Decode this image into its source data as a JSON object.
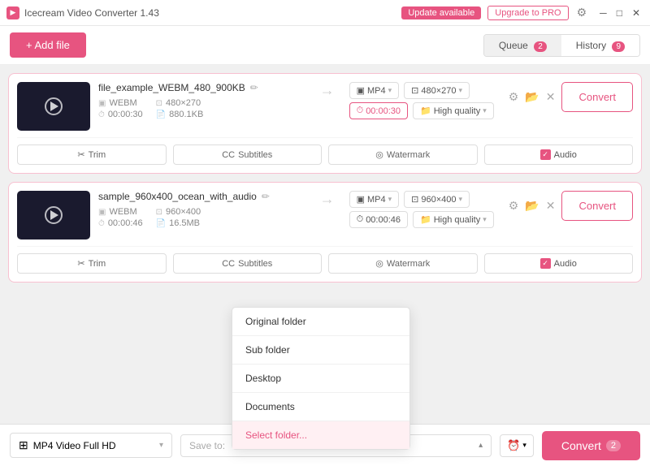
{
  "app": {
    "title": "Icecream Video Converter 1.43",
    "update_label": "Update available",
    "upgrade_label": "Upgrade to PRO"
  },
  "toolbar": {
    "add_file_label": "+ Add file",
    "queue_label": "Queue",
    "queue_count": "2",
    "history_label": "History",
    "history_count": "9"
  },
  "videos": [
    {
      "filename": "file_example_WEBM_480_900KB",
      "src_format": "WEBM",
      "src_resolution": "480×270",
      "src_duration": "00:00:30",
      "src_size": "880.1KB",
      "dst_format": "MP4",
      "dst_resolution": "480×270",
      "dst_duration": "00:00:30",
      "dst_quality": "High quality",
      "convert_label": "Convert",
      "trim_label": "Trim",
      "subtitles_label": "Subtitles",
      "watermark_label": "Watermark",
      "audio_label": "Audio"
    },
    {
      "filename": "sample_960x400_ocean_with_audio",
      "src_format": "WEBM",
      "src_resolution": "960×400",
      "src_duration": "00:00:46",
      "src_size": "16.5MB",
      "dst_format": "MP4",
      "dst_resolution": "960×400",
      "dst_duration": "00:00:46",
      "dst_quality": "High quality",
      "convert_label": "Convert",
      "trim_label": "Trim",
      "subtitles_label": "Subtitles",
      "watermark_label": "Watermark",
      "audio_label": "Audio"
    }
  ],
  "dropdown": {
    "items": [
      {
        "label": "Original folder",
        "active": false
      },
      {
        "label": "Sub folder",
        "active": false
      },
      {
        "label": "Desktop",
        "active": false
      },
      {
        "label": "Documents",
        "active": false
      },
      {
        "label": "Select folder...",
        "active": true
      }
    ]
  },
  "bottom_bar": {
    "format_label": "MP4 Video Full HD",
    "save_to_placeholder": "Save to:",
    "convert_label": "Convert",
    "convert_count": "2"
  }
}
